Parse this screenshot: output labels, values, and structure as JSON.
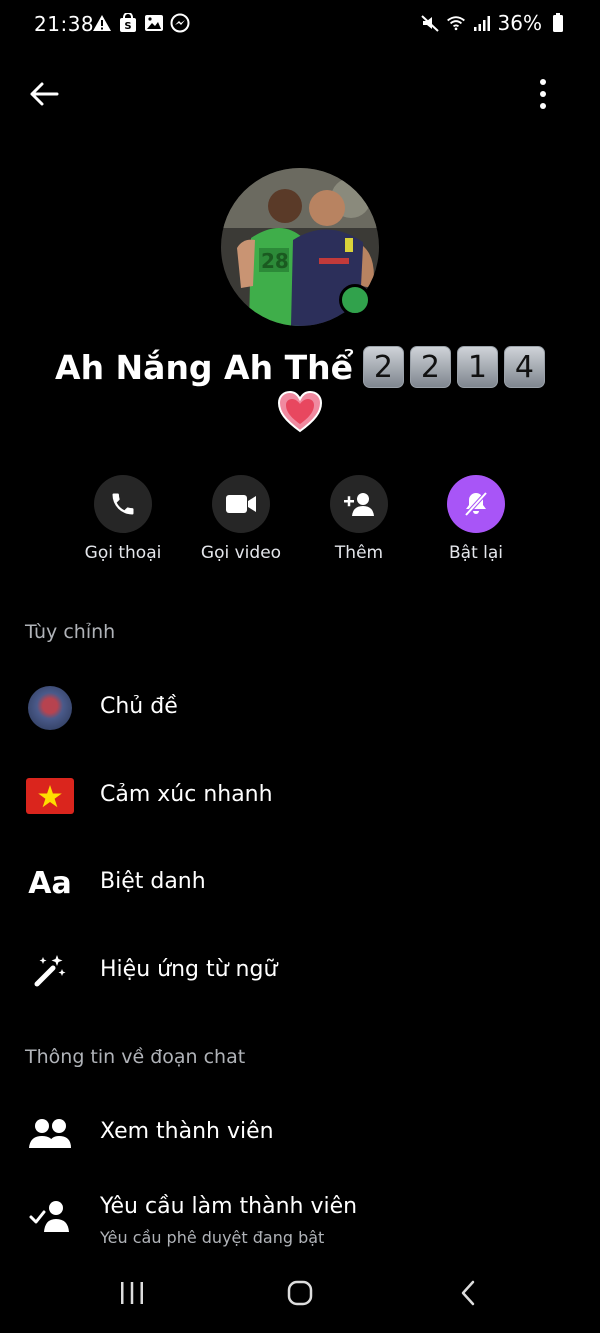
{
  "status_bar": {
    "time": "21:38",
    "battery": "36%",
    "left_icons": [
      "warning-icon",
      "shopee-icon",
      "gallery-icon",
      "messenger-icon"
    ],
    "right_icons": [
      "mute-icon",
      "wifi-icon",
      "signal-icon",
      "battery-icon"
    ]
  },
  "profile": {
    "name": "Ah Nắng Ah Thể",
    "number_tiles": [
      "2",
      "2",
      "1",
      "4"
    ],
    "heart": "💗",
    "online_color": "#31a24c"
  },
  "actions": [
    {
      "label": "Gọi thoại",
      "icon": "phone-icon"
    },
    {
      "label": "Gọi video",
      "icon": "video-camera-icon"
    },
    {
      "label": "Thêm",
      "icon": "add-person-icon"
    },
    {
      "label": "Bật lại",
      "icon": "muted-bell-icon",
      "accent": "#a855f7"
    }
  ],
  "sections": {
    "customize_title": "Tùy chỉnh",
    "chat_info_title": "Thông tin về đoạn chat"
  },
  "customize_items": [
    {
      "label": "Chủ đề",
      "icon": "theme-thumbnail"
    },
    {
      "label": "Cảm xúc nhanh",
      "icon": "vietnam-flag-emoji"
    },
    {
      "label": "Biệt danh",
      "icon": "aa-text-icon",
      "icon_text": "Aa"
    },
    {
      "label": "Hiệu ứng từ ngữ",
      "icon": "magic-wand-icon"
    }
  ],
  "chat_info_items": [
    {
      "label": "Xem thành viên",
      "icon": "people-icon"
    },
    {
      "label": "Yêu cầu làm thành viên",
      "sublabel": "Yêu cầu phê duyệt đang bật",
      "icon": "person-check-icon"
    }
  ],
  "nav": [
    "recent-apps-icon",
    "home-icon",
    "back-nav-icon"
  ]
}
